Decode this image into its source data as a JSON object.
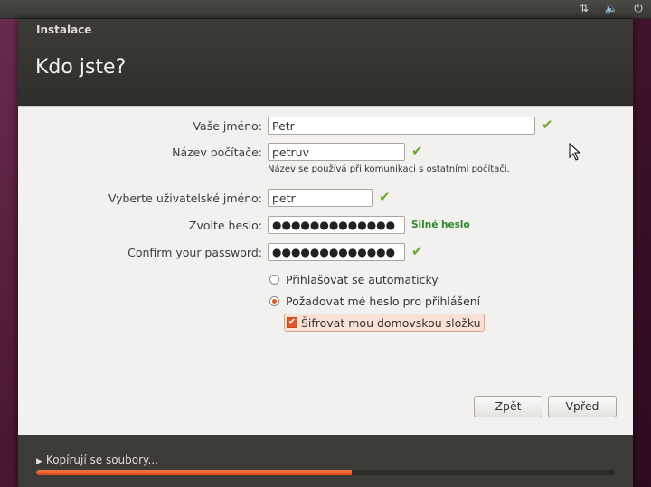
{
  "tray": {
    "network_icon": "network-updown-icon",
    "sound_icon": "speaker-icon",
    "power_icon": "power-icon"
  },
  "window": {
    "title": "Instalace",
    "page_title": "Kdo jste?"
  },
  "form": {
    "name_label": "Vaše jméno:",
    "name_value": "Petr",
    "computer_label": "Název počítače:",
    "computer_value": "petruv",
    "computer_hint": "Název se používá při komunikaci s ostatními počítači.",
    "username_label": "Vyberte uživatelské jméno:",
    "username_value": "petr",
    "password_label": "Zvolte heslo:",
    "password_value": "●●●●●●●●●●●●●",
    "password_strength": "Silné heslo",
    "confirm_label": "Confirm your password:",
    "confirm_value": "●●●●●●●●●●●●●",
    "login_auto_label": "Přihlašovat se automaticky",
    "login_password_label": "Požadovat mé heslo pro přihlášení",
    "encrypt_label": "Šifrovat mou domovskou složku",
    "login_mode": "password",
    "encrypt_checked": true
  },
  "buttons": {
    "back": "Zpět",
    "forward": "Vpřed"
  },
  "progress": {
    "label": "Kopírují se soubory...",
    "fraction": 0.545
  },
  "colors": {
    "accent": "#dd4814",
    "valid": "#6ba82b",
    "strength": "#2b8a2b"
  }
}
